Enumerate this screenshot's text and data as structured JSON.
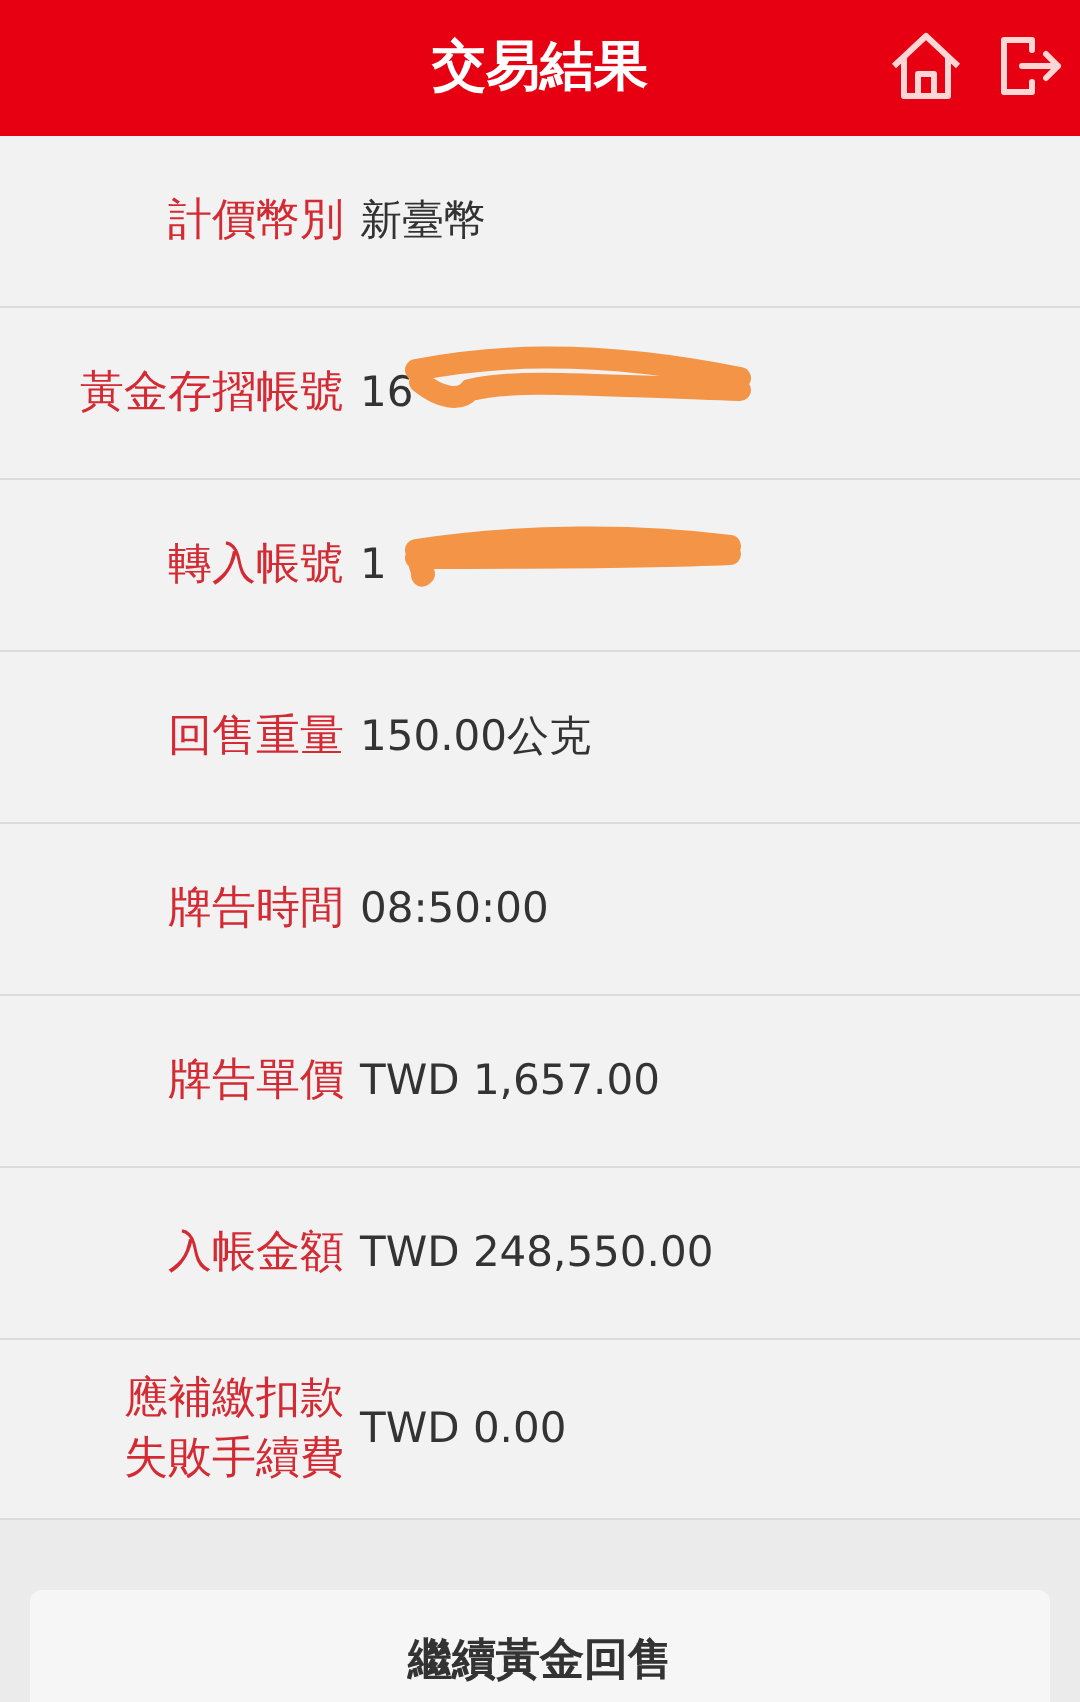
{
  "header": {
    "title": "交易結果"
  },
  "rows": [
    {
      "label": "計價幣別",
      "value": "新臺幣",
      "redacted": false
    },
    {
      "label": "黃金存摺帳號",
      "value": "16",
      "redacted": true
    },
    {
      "label": "轉入帳號",
      "value": "1",
      "redacted": true
    },
    {
      "label": "回售重量",
      "value": "150.00公克",
      "redacted": false
    },
    {
      "label": "牌告時間",
      "value": "08:50:00",
      "redacted": false
    },
    {
      "label": "牌告單價",
      "value": "TWD 1,657.00",
      "redacted": false
    },
    {
      "label": "入帳金額",
      "value": "TWD 248,550.00",
      "redacted": false
    },
    {
      "label_lines": [
        "應補繳扣款",
        "失敗手續費"
      ],
      "value": "TWD 0.00",
      "redacted": false
    }
  ],
  "buttons": [
    {
      "label": "繼續黃金回售"
    }
  ]
}
